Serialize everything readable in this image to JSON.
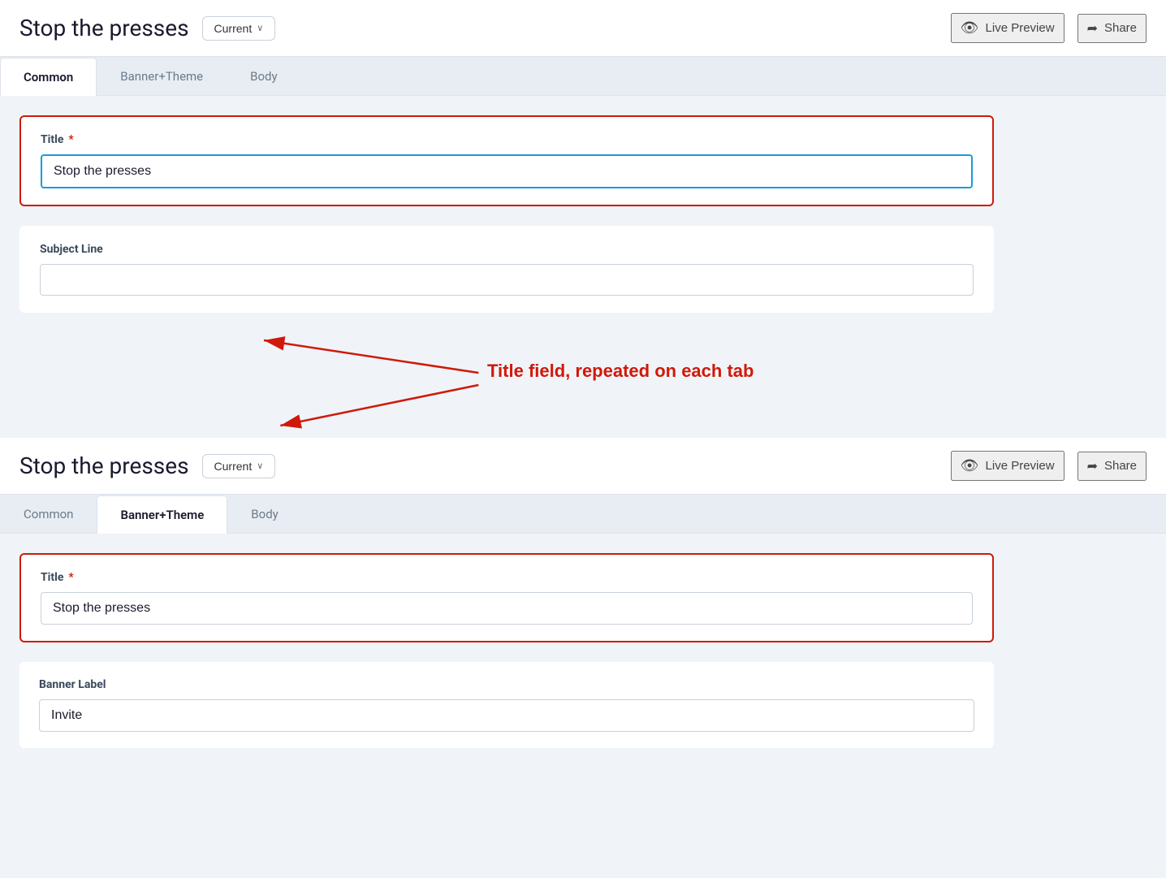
{
  "app": {
    "title": "Stop the presses"
  },
  "panel_top": {
    "title": "Stop the presses",
    "version_label": "Current",
    "version_chevron": "∨",
    "live_preview_label": "Live Preview",
    "share_label": "Share",
    "tabs": [
      {
        "id": "common",
        "label": "Common",
        "active": true
      },
      {
        "id": "banner_theme",
        "label": "Banner+Theme",
        "active": false
      },
      {
        "id": "body",
        "label": "Body",
        "active": false
      }
    ],
    "form": {
      "title_label": "Title",
      "title_required": "*",
      "title_value": "Stop the presses",
      "subject_label": "Subject Line",
      "subject_value": "",
      "subject_placeholder": ""
    }
  },
  "annotation": {
    "text": "Title field, repeated on each tab"
  },
  "panel_bottom": {
    "title": "Stop the presses",
    "version_label": "Current",
    "version_chevron": "∨",
    "live_preview_label": "Live Preview",
    "share_label": "Share",
    "tabs": [
      {
        "id": "common",
        "label": "Common",
        "active": false
      },
      {
        "id": "banner_theme",
        "label": "Banner+Theme",
        "active": true
      },
      {
        "id": "body",
        "label": "Body",
        "active": false
      }
    ],
    "form": {
      "title_label": "Title",
      "title_required": "*",
      "title_value": "Stop the presses",
      "banner_label": "Banner Label",
      "banner_value": "Invite"
    }
  },
  "icons": {
    "eye": "👁",
    "share": "➦",
    "chevron_down": "∨"
  }
}
